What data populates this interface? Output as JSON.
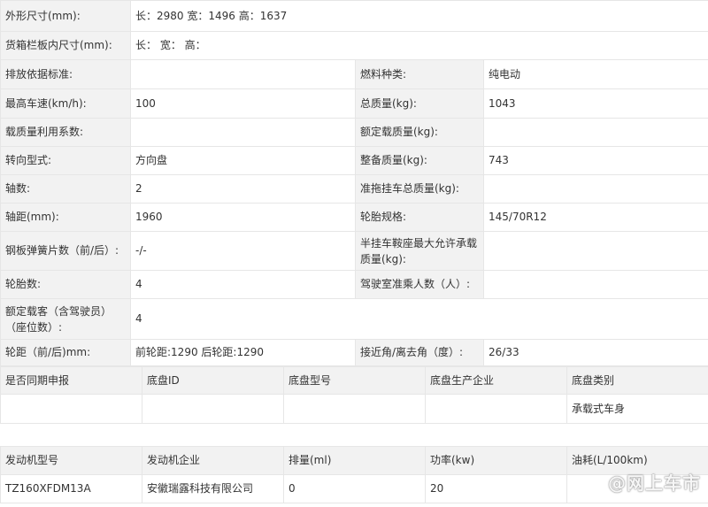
{
  "spec": {
    "size_label": "外形尺寸(mm):",
    "size_value": "长：2980 宽：1496 高：1637",
    "cargo_label": "货箱栏板内尺寸(mm):",
    "cargo_value": "长： 宽： 高：",
    "emission_label": "排放依据标准:",
    "emission_value": "",
    "fuel_label": "燃料种类:",
    "fuel_value": "纯电动",
    "speed_label": "最高车速(km/h):",
    "speed_value": "100",
    "total_mass_label": "总质量(kg):",
    "total_mass_value": "1043",
    "load_util_label": "载质量利用系数:",
    "load_util_value": "",
    "rated_load_label": "额定载质量(kg):",
    "rated_load_value": "",
    "steering_label": "转向型式:",
    "steering_value": "方向盘",
    "curb_mass_label": "整备质量(kg):",
    "curb_mass_value": "743",
    "axles_label": "轴数:",
    "axles_value": "2",
    "trailer_mass_label": "准拖挂车总质量(kg):",
    "trailer_mass_value": "",
    "wheelbase_label": "轴距(mm):",
    "wheelbase_value": "1960",
    "tire_spec_label": "轮胎规格:",
    "tire_spec_value": "145/70R12",
    "leaf_spring_label": "钢板弹簧片数（前/后）:",
    "leaf_spring_value": "-/-",
    "saddle_label": "半挂车鞍座最大允许承载质量(kg):",
    "saddle_value": "",
    "tires_label": "轮胎数:",
    "tires_value": "4",
    "cab_seats_label": "驾驶室准乘人数（人）:",
    "cab_seats_value": "",
    "passengers_label": "额定载客（含驾驶员）（座位数）:",
    "passengers_value": "4",
    "track_label": "轮距（前/后)mm:",
    "track_value": "前轮距:1290 后轮距:1290",
    "angle_label": "接近角/离去角（度）:",
    "angle_value": "26/33"
  },
  "chassis": {
    "headers": [
      "是否同期申报",
      "底盘ID",
      "底盘型号",
      "底盘生产企业",
      "底盘类别"
    ],
    "row": [
      "",
      "",
      "",
      "",
      "承载式车身"
    ]
  },
  "engine": {
    "headers": [
      "发动机型号",
      "发动机企业",
      "排量(ml)",
      "功率(kw)",
      "油耗(L/100km)"
    ],
    "row": [
      "TZ160XFDM13A",
      "安徽瑞露科技有限公司",
      "0",
      "20",
      ""
    ]
  },
  "watermark": "@网上车市"
}
